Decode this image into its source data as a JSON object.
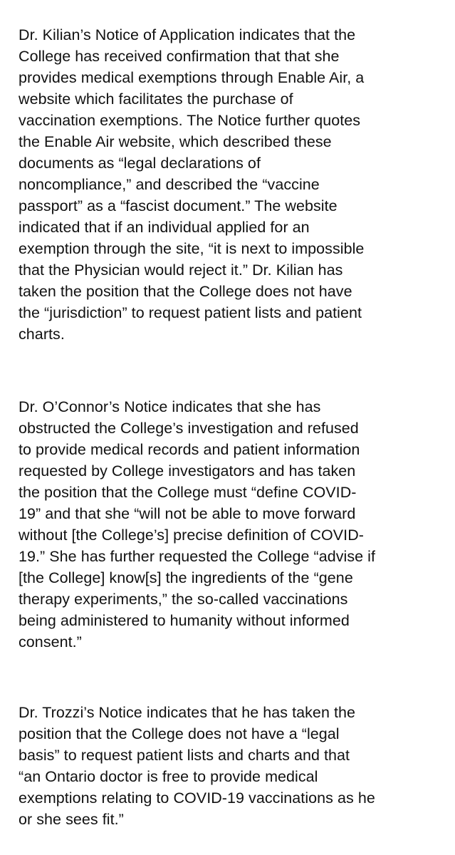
{
  "document": {
    "paragraphs": [
      {
        "lines": [
          "Dr. Kilian’s Notice of Application indicates that the",
          "College has received confirmation that that she",
          "provides medical exemptions through Enable Air, a",
          "website which facilitates the purchase of",
          "vaccination exemptions. The Notice further quotes",
          "the Enable Air website, which described these",
          "documents as “legal declarations of",
          "noncompliance,” and described the “vaccine",
          "passport” as a “fascist document.” The website",
          "indicated that if an individual applied for an",
          "exemption through the site, “it is next to impossible",
          "that the Physician would reject it.” Dr. Kilian has",
          "taken the position that the College does not have",
          "the “jurisdiction” to request patient lists and patient",
          "charts."
        ]
      },
      {
        "lines": [
          "Dr. O’Connor’s Notice indicates that she has",
          "obstructed the College’s investigation and refused",
          "to provide medical records and patient information",
          "requested by College investigators and has taken",
          "the position that the College must “define COVID-",
          "19” and that she “will not be able to move forward",
          "without [the College’s] precise definition of COVID-",
          "19.” She has further requested the College “advise if",
          "[the College] know[s] the ingredients of the “gene",
          "therapy experiments,” the so-called vaccinations",
          "being administered to humanity without informed",
          "consent.”"
        ]
      },
      {
        "lines": [
          "Dr. Trozzi’s Notice indicates that he has taken the",
          "position that the College does not have a “legal",
          "basis” to request patient lists and charts and that",
          "“an Ontario doctor is free to provide medical",
          "exemptions relating to COVID-19 vaccinations as he",
          "or she sees fit.”"
        ]
      }
    ]
  }
}
